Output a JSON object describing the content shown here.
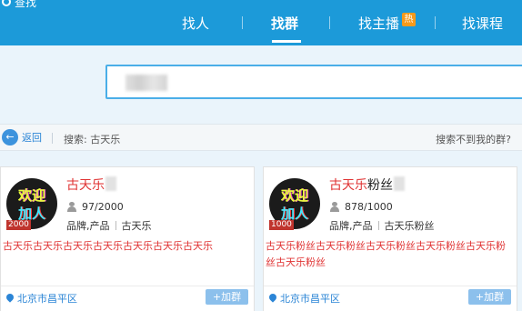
{
  "header": {
    "cut_title": "查找",
    "nav": [
      {
        "label": "找人"
      },
      {
        "label": "找群"
      },
      {
        "label": "找主播"
      },
      {
        "label": "找课程"
      }
    ],
    "hot_badge": "热"
  },
  "search": {
    "value": ""
  },
  "crumbbar": {
    "back_label": "返回",
    "search_prefix": "搜索: 古天乐",
    "cant_find": "搜索不到我的群?"
  },
  "cards": [
    {
      "avatar_line1": "欢迎",
      "avatar_line2": "加人",
      "capacity": "2000",
      "name_red": "古天乐",
      "name_black": "",
      "members": "97/2000",
      "tag1": "品牌,产品",
      "tag2": "古天乐",
      "desc_red": "古天乐古天乐古天乐古天乐古天乐古天乐古天乐",
      "desc_grey": "",
      "location": "北京市昌平区",
      "join_label": "+加群"
    },
    {
      "avatar_line1": "欢迎",
      "avatar_line2": "加人",
      "capacity": "1000",
      "name_red": "古天乐",
      "name_black": "粉丝",
      "members": "878/1000",
      "tag1": "品牌,产品",
      "tag2": "古天乐粉丝",
      "desc_red": "古天乐粉丝古天乐粉丝古天乐粉丝古天乐粉丝古天乐粉丝古天乐粉丝",
      "desc_grey": "",
      "location": "北京市昌平区",
      "join_label": "+加群"
    }
  ]
}
